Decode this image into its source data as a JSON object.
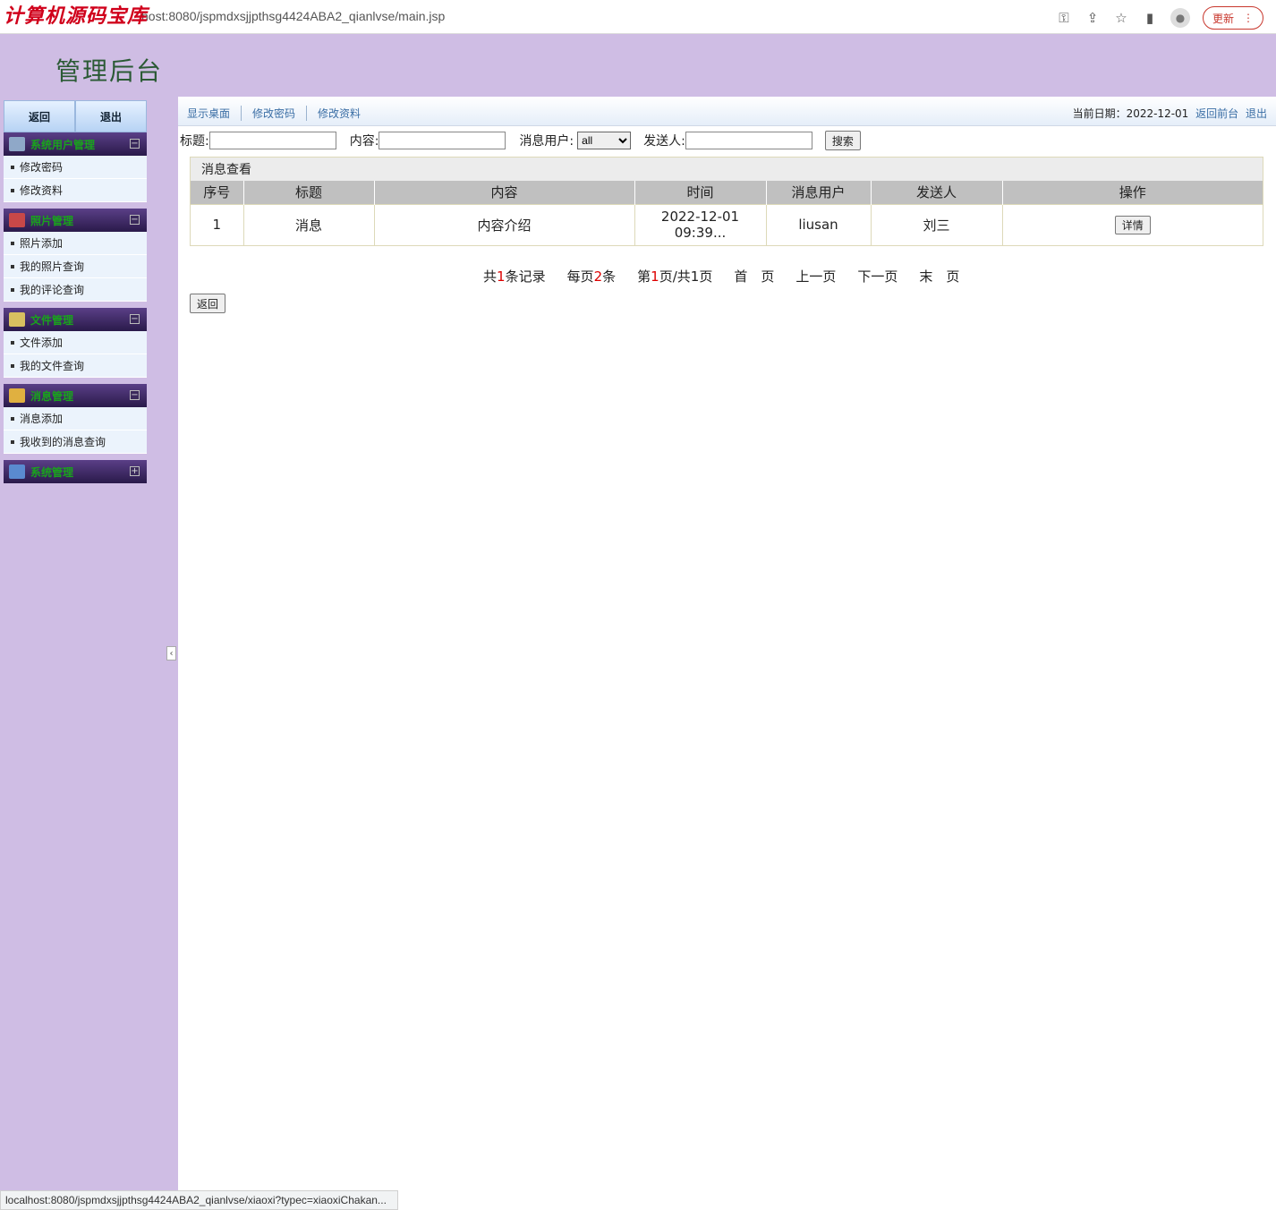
{
  "browser": {
    "watermark": "计算机源码宝库",
    "url": "host:8080/jspmdxsjjpthsg4424ABA2_qianlvse/main.jsp",
    "update_label": "更新",
    "status_url": "localhost:8080/jspmdxsjjpthsg4424ABA2_qianlvse/xiaoxi?typec=xiaoxiChakan..."
  },
  "header": {
    "title": "管理后台"
  },
  "sidebar": {
    "back_label": "返回",
    "logout_label": "退出",
    "menus": [
      {
        "title": "系统用户管理",
        "icon": "gear-icon",
        "icon_color": "#8fa8c8",
        "toggle": "−",
        "items": [
          "修改密码",
          "修改资料"
        ]
      },
      {
        "title": "照片管理",
        "icon": "photo-icon",
        "icon_color": "#c84848",
        "toggle": "−",
        "items": [
          "照片添加",
          "我的照片查询",
          "我的评论查询"
        ]
      },
      {
        "title": "文件管理",
        "icon": "folder-icon",
        "icon_color": "#d8c060",
        "toggle": "−",
        "items": [
          "文件添加",
          "我的文件查询"
        ]
      },
      {
        "title": "消息管理",
        "icon": "message-icon",
        "icon_color": "#e0b040",
        "toggle": "−",
        "items": [
          "消息添加",
          "我收到的消息查询"
        ]
      },
      {
        "title": "系统管理",
        "icon": "chart-icon",
        "icon_color": "#5a8ad0",
        "toggle": "+",
        "items": []
      }
    ]
  },
  "topnav": {
    "links": [
      "显示桌面",
      "修改密码",
      "修改资料"
    ],
    "date_prefix": "当前日期：2022-12-01",
    "front_link": "返回前台",
    "logout_link": "退出"
  },
  "search": {
    "title_label": "标题:",
    "content_label": "内容:",
    "user_label": "消息用户:",
    "user_selected": "all",
    "sender_label": "发送人:",
    "search_button": "搜索"
  },
  "table": {
    "caption": "消息查看",
    "headers": [
      "序号",
      "标题",
      "内容",
      "时间",
      "消息用户",
      "发送人",
      "操作"
    ],
    "rows": [
      {
        "index": "1",
        "title": "消息",
        "content": "内容介绍",
        "time_line1": "2022-12-01",
        "time_line2": "09:39...",
        "user": "liusan",
        "sender": "刘三",
        "action": "详情"
      }
    ]
  },
  "pager": {
    "total_prefix": "共",
    "total": "1",
    "total_suffix": "条记录",
    "per_prefix": "每页",
    "per": "2",
    "per_suffix": "条",
    "page_prefix": "第",
    "page": "1",
    "page_suffix": "页/共1页",
    "first": "首　页",
    "prev": "上一页",
    "next": "下一页",
    "last": "末　页"
  },
  "back_button": "返回"
}
